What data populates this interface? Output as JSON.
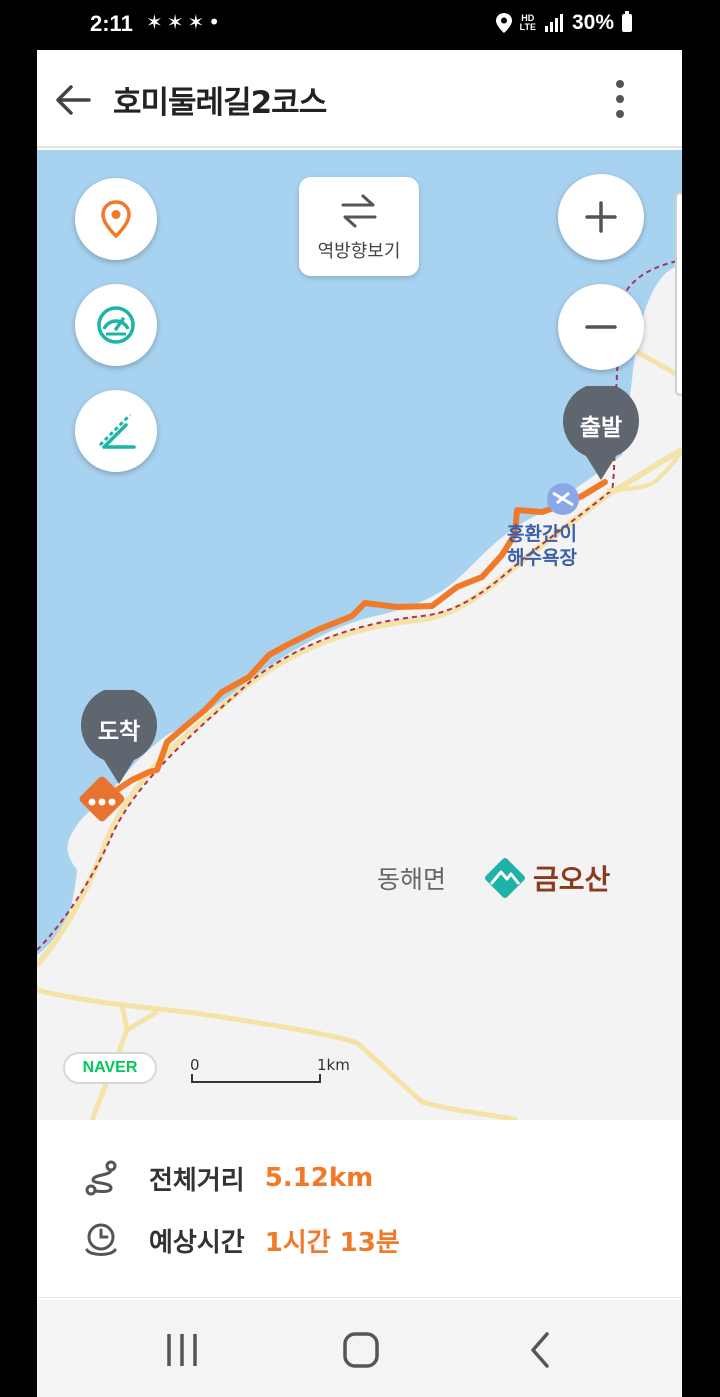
{
  "status_bar": {
    "time": "2:11",
    "notification_icons": [
      "shoe-icon",
      "shoe-icon",
      "shoe-icon"
    ],
    "dot": "•",
    "hd_line1": "HD",
    "hd_line2": "LTE",
    "battery": "30%"
  },
  "header": {
    "title": "호미둘레길2코스",
    "back_icon": "back-arrow-icon",
    "more_icon": "more-vert-icon"
  },
  "map": {
    "reverse_button_label": "역방향보기",
    "start_marker": "출발",
    "end_marker": "도착",
    "poi_beach_line1": "흥환간이",
    "poi_beach_line2": "해수욕장",
    "poi_area": "동해면",
    "poi_mountain": "금오산",
    "provider": "NAVER",
    "scale_start": "0",
    "scale_end": "1km",
    "colors": {
      "water": "#a8d3f0",
      "land": "#f3f3f3",
      "route": "#f07a2a",
      "road": "#f4e3a8",
      "pin": "#5f6670"
    }
  },
  "info": {
    "distance_label": "전체거리",
    "distance_value": "5.12km",
    "time_label": "예상시간",
    "time_value": "1시간 13분"
  },
  "navbar": {
    "recent_icon": "recent-apps-icon",
    "home_icon": "home-icon",
    "back_icon": "back-icon"
  }
}
